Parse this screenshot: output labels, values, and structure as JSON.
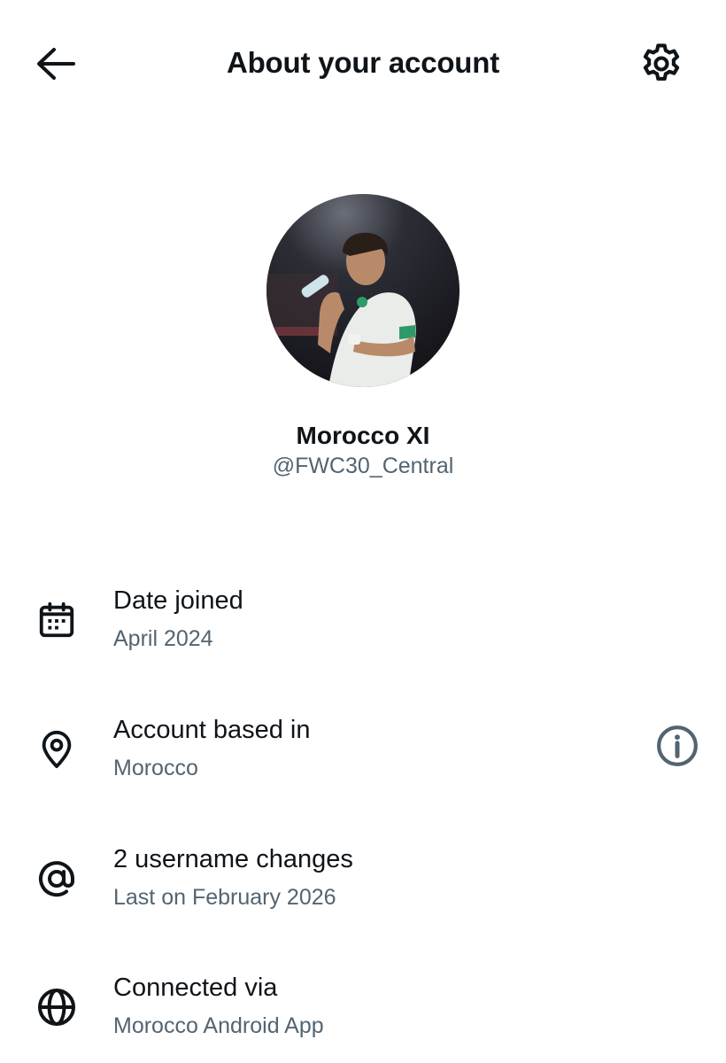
{
  "header": {
    "title": "About your account",
    "back_icon": "arrow-left-icon",
    "settings_icon": "gear-icon"
  },
  "profile": {
    "display_name": "Morocco XI",
    "handle": "@FWC30_Central",
    "avatar": "profile-photo"
  },
  "rows": [
    {
      "label": "Date joined",
      "value": "April 2024",
      "icon": "calendar-icon"
    },
    {
      "label": "Account based in",
      "value": "Morocco",
      "icon": "location-pin-icon",
      "action_icon": "info-icon"
    },
    {
      "label": "2 username changes",
      "value": "Last on February 2026",
      "icon": "at-sign-icon"
    },
    {
      "label": "Connected via",
      "value": "Morocco Android App",
      "icon": "globe-icon"
    }
  ],
  "colors": {
    "text_primary": "#0f1419",
    "text_secondary": "#536471",
    "info_icon": "#536471",
    "background": "#ffffff"
  }
}
